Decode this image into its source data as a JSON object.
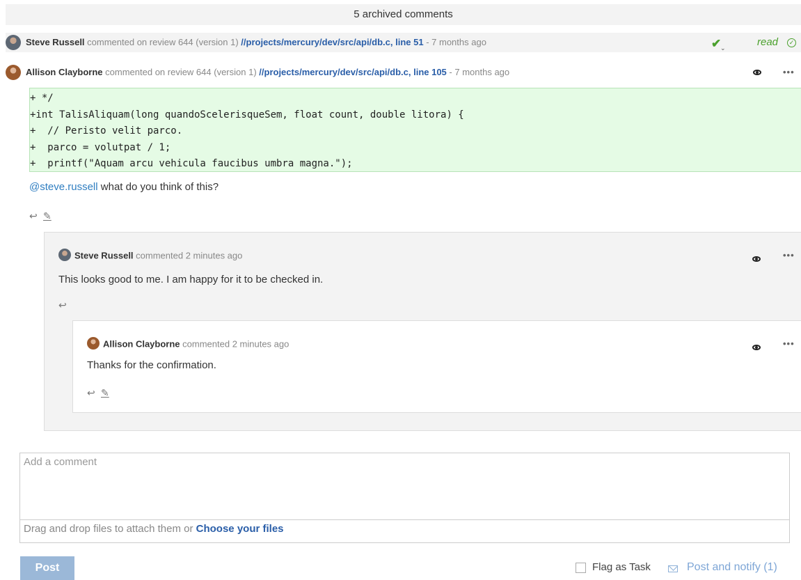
{
  "archived": {
    "label": "5 archived comments"
  },
  "comments": [
    {
      "author": "Steve Russell",
      "verb": "commented on review 644 (version 1)",
      "path": "//projects/mercury/dev/src/api/db.c, line 51",
      "time": "- 7 months ago",
      "read_label": "read"
    },
    {
      "author": "Allison Clayborne",
      "verb": "commented on review 644 (version 1)",
      "path": "//projects/mercury/dev/src/api/db.c, line 105",
      "time": "- 7 months ago",
      "code": [
        "+ */",
        "+int TalisAliquam(long quandoScelerisqueSem, float count, double litora) {",
        "+  // Peristo velit parco.",
        "+  parco = volutpat / 1;",
        "+  printf(\"Aquam arcu vehicula faucibus umbra magna.\");"
      ],
      "mention": "@steve.russell",
      "body": "what do you think of this?"
    }
  ],
  "replies": [
    {
      "author": "Steve Russell",
      "verb": "commented 2 minutes ago",
      "body": "This looks good to me. I am happy for it to be checked in."
    },
    {
      "author": "Allison Clayborne",
      "verb": "commented 2 minutes ago",
      "body": "Thanks for the confirmation."
    }
  ],
  "composer": {
    "placeholder": "Add a comment",
    "drop_text": "Drag and drop files to attach them or",
    "choose_files": "Choose your files",
    "post_label": "Post",
    "flag_label": "Flag as Task",
    "notify_label": "Post and notify (1)"
  },
  "icons": {
    "read_check": "check-icon",
    "read_status": "read-check-circle-icon",
    "watch": "eye-icon",
    "more": "more-icon",
    "reply": "reply-icon",
    "edit": "edit-icon",
    "notify": "envelope-icon"
  }
}
